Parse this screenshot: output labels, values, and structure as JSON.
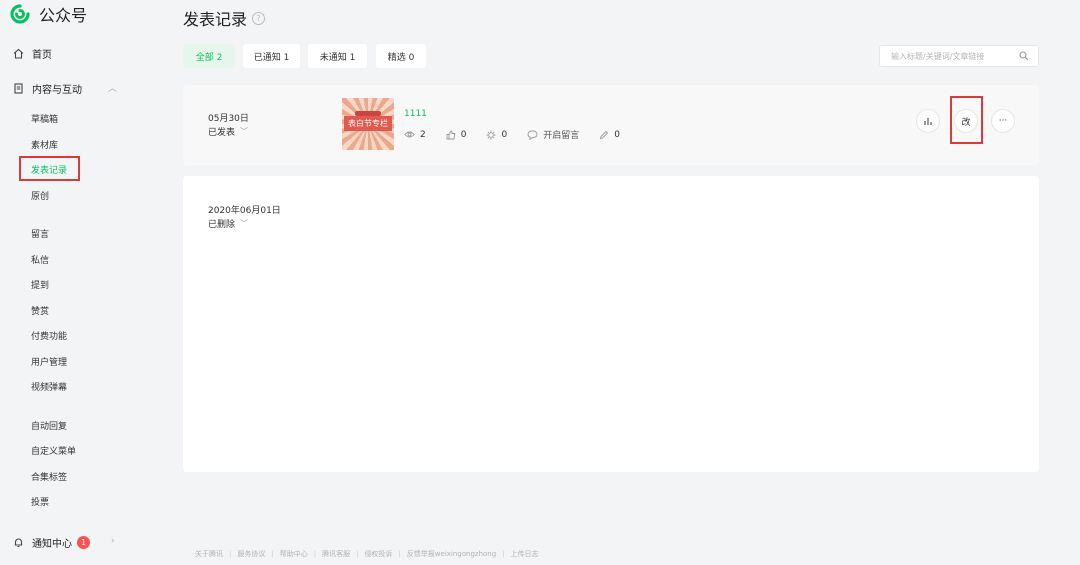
{
  "app": {
    "logo_text": "公众号"
  },
  "sidebar": {
    "home": "首页",
    "content_section": "内容与互动",
    "content_items": [
      "草稿箱",
      "素材库",
      "发表记录",
      "原创"
    ],
    "interaction_items": [
      "留言",
      "私信",
      "提到",
      "赞赏",
      "付费功能",
      "用户管理",
      "视频弹幕"
    ],
    "feature_items": [
      "自动回复",
      "自定义菜单",
      "合集标签",
      "投票"
    ],
    "notifications": {
      "label": "通知中心",
      "count": "1"
    }
  },
  "page": {
    "title": "发表记录",
    "help": "?"
  },
  "tabs": [
    {
      "label": "全部 2"
    },
    {
      "label": "已通知 1"
    },
    {
      "label": "未通知 1"
    },
    {
      "label": "精选 0"
    }
  ],
  "search": {
    "placeholder": "输入标题/关键词/文章链接"
  },
  "records": [
    {
      "date": "05月30日",
      "status": "已发表",
      "thumbnail_text": "表白节专栏",
      "title": "1111",
      "views": "2",
      "likes": "0",
      "shares": "0",
      "comments_label": "开启留言",
      "edits": "0",
      "actions": {
        "stats_icon": "bar-chart-icon",
        "edit_label": "改",
        "more_label": "···"
      }
    },
    {
      "date": "2020年06月01日",
      "status": "已删除"
    }
  ],
  "footer": [
    "关于腾讯",
    "服务协议",
    "帮助中心",
    "腾讯客服",
    "侵权投诉",
    "反馈举报weixingongzhong",
    "上传日志"
  ],
  "colors": {
    "accent": "#07c160",
    "highlight_box": "#d93a3a",
    "badge": "#fa5151"
  }
}
